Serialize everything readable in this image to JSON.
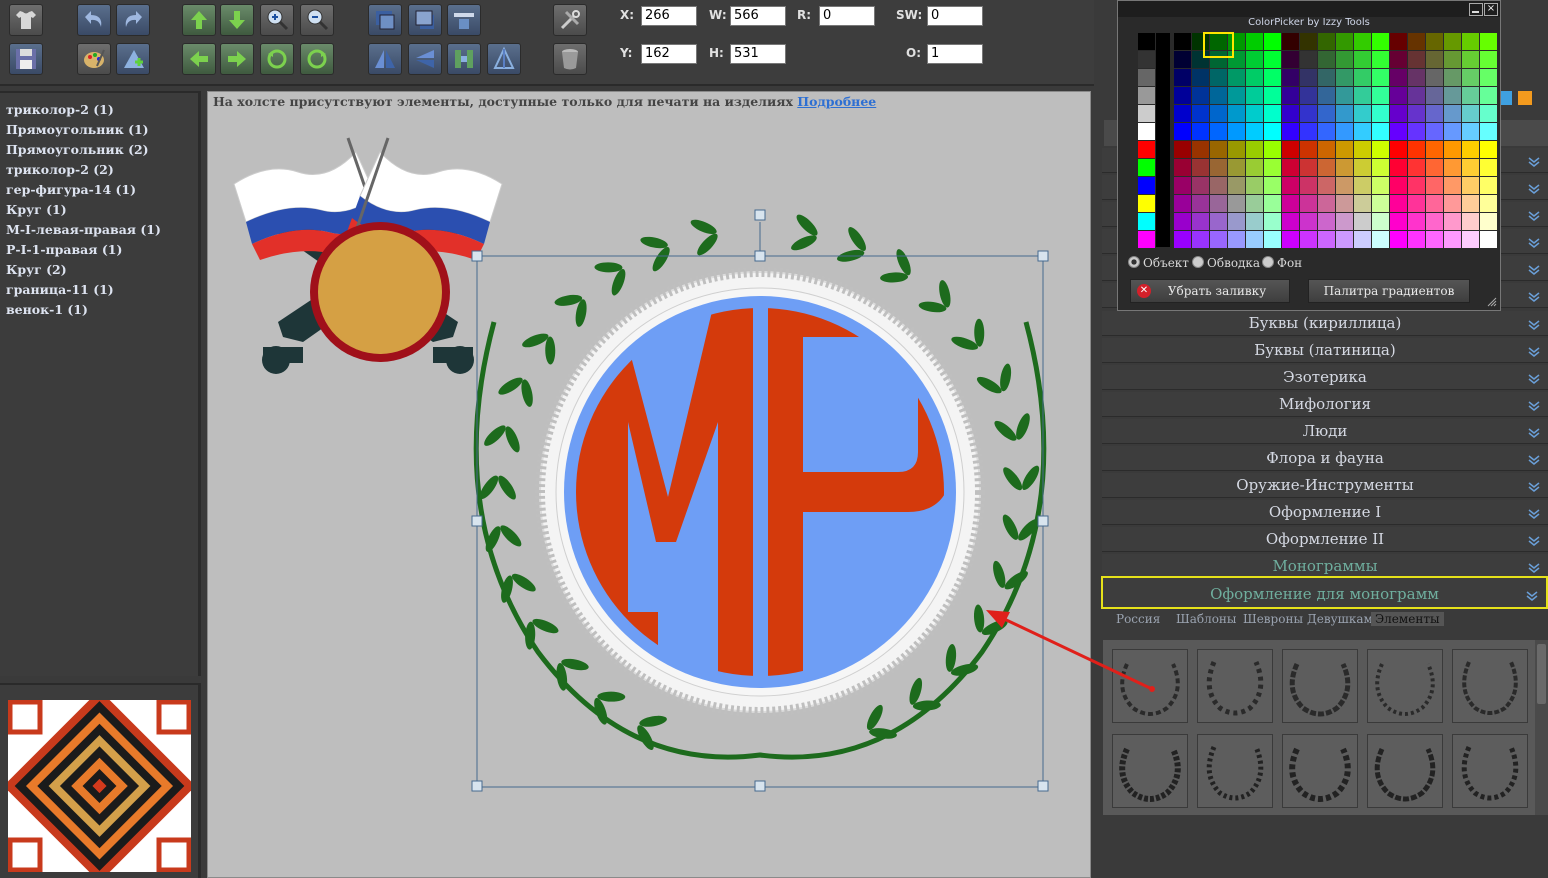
{
  "toolbar": {
    "x_label": "X:",
    "x_value": "266",
    "y_label": "Y:",
    "y_value": "162",
    "w_label": "W:",
    "w_value": "566",
    "h_label": "H:",
    "h_value": "531",
    "r_label": "R:",
    "r_value": "0",
    "sw_label": "SW:",
    "sw_value": "0",
    "o_label": "O:",
    "o_value": "1"
  },
  "layers": [
    "триколор-2 (1)",
    "Прямоугольник (1)",
    "Прямоугольник (2)",
    "триколор-2 (2)",
    "гер-фигура-14 (1)",
    "Круг (1)",
    "М-I-левая-правая (1)",
    "Р-I-1-правая (1)",
    "Круг (2)",
    "граница-11 (1)",
    "венок-1 (1)"
  ],
  "canvas": {
    "notice": "На холсте присутствуют элементы, доступные только для печати на изделиях",
    "notice_link": "Подробнее",
    "monogram_letters": "МР"
  },
  "color_picker": {
    "title": "ColorPicker by Izzy Tools",
    "radio_object": "Объект",
    "radio_stroke": "Обводка",
    "radio_background": "Фон",
    "remove_fill": "Убрать заливку",
    "gradient_palette": "Палитра градиентов"
  },
  "categories": [
    "Буквы (кириллица)",
    "Буквы (латиница)",
    "Эзотерика",
    "Мифология",
    "Люди",
    "Флора и фауна",
    "Оружие-Инструменты",
    "Оформление I",
    "Оформление II",
    "Монограммы",
    "Оформление для монограмм"
  ],
  "subtabs": [
    "Россия",
    "Шаблоны",
    "Шевроны",
    "Девушкам",
    "Элементы"
  ],
  "colors": {
    "accent_highlight": "#e6e21a",
    "monogram_red": "#d43a0c",
    "monogram_blue": "#6e9ef5",
    "wreath_green": "#1d6b1d",
    "arrow_red": "#e0201a"
  }
}
